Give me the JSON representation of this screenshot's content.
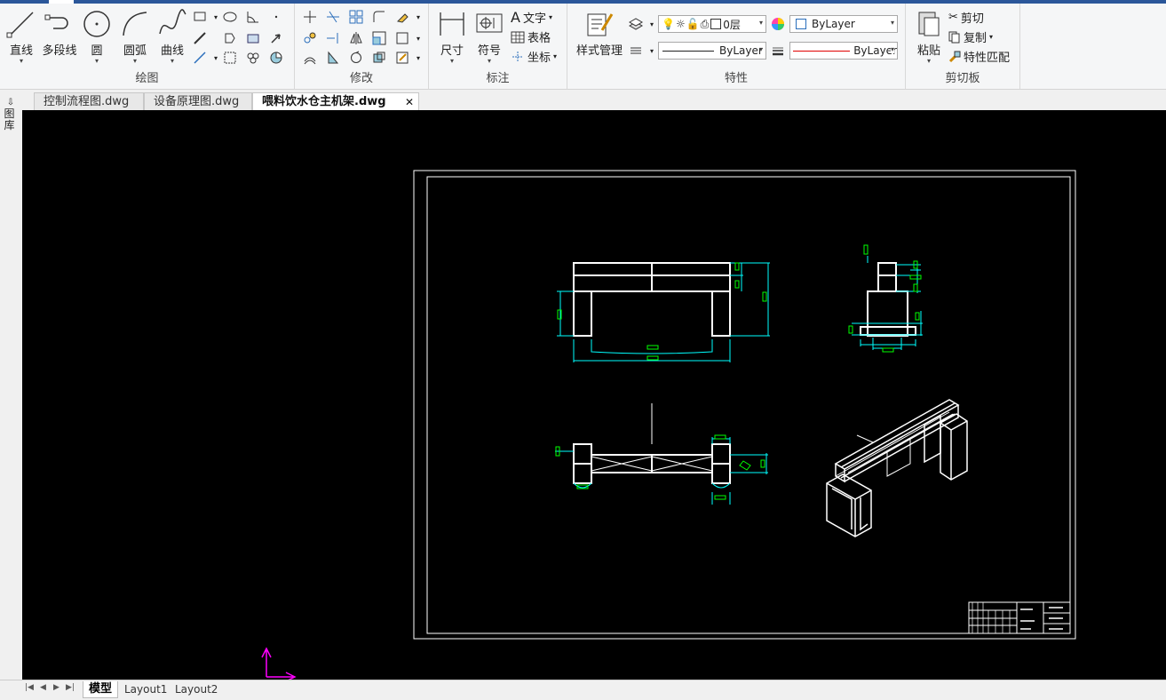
{
  "ribbon": {
    "draw": {
      "title": "绘图",
      "line": "直线",
      "polyline": "多段线",
      "circle": "圆",
      "arc": "圆弧",
      "curve": "曲线"
    },
    "modify": {
      "title": "修改"
    },
    "annotate": {
      "title": "标注",
      "dimension": "尺寸",
      "symbol": "符号",
      "text": "文字",
      "table": "表格",
      "coordinate": "坐标"
    },
    "properties": {
      "title": "特性",
      "style_manager": "样式管理",
      "layer_value": "0层",
      "color_value": "ByLayer",
      "linetype_value": "ByLayer",
      "lineweight_value": "ByLayer"
    },
    "clipboard": {
      "title": "剪切板",
      "paste": "粘贴",
      "cut": "剪切",
      "copy": "复制",
      "match_props": "特性匹配"
    }
  },
  "doc_tabs": [
    {
      "label": "控制流程图.dwg"
    },
    {
      "label": "设备原理图.dwg"
    },
    {
      "label": "喂料饮水仓主机架.dwg"
    }
  ],
  "sidebar": {
    "label": "图库"
  },
  "layout_tabs": [
    {
      "label": "模型"
    },
    {
      "label": "Layout1"
    },
    {
      "label": "Layout2"
    }
  ],
  "colors": {
    "ribbon_accent": "#2b579a",
    "canvas_bg": "#000000",
    "drawing_line": "#ffffff",
    "dimension_line": "#00ffff",
    "dimension_text": "#00ff00",
    "ucs_icon": "#ff00ff",
    "lineweight_red": "#e00000"
  }
}
